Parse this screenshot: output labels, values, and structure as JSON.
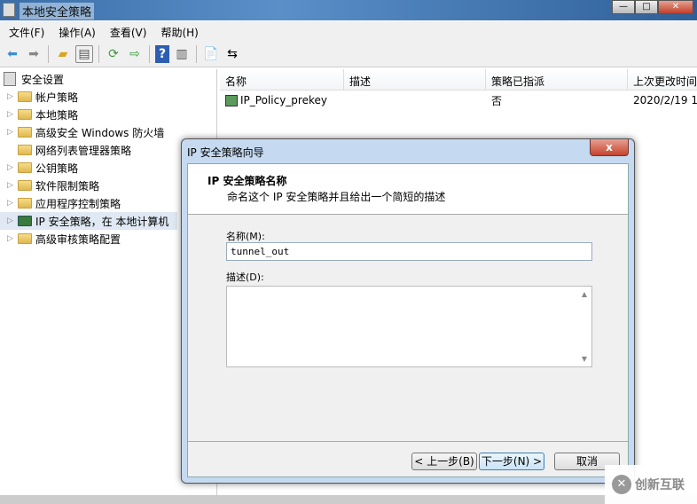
{
  "window": {
    "title": "本地安全策略",
    "minimize": "—",
    "maximize": "□",
    "close": "✕"
  },
  "menu": [
    "文件(F)",
    "操作(A)",
    "查看(V)",
    "帮助(H)"
  ],
  "toolbar": [
    "back-icon",
    "forward-icon",
    "up-folder-icon",
    "show-hide-tree-icon",
    "refresh-icon",
    "export-icon",
    "help-icon",
    "properties-icon",
    "new-policy-icon",
    "manage-filters-icon"
  ],
  "tree": {
    "root": "安全设置",
    "items": [
      "帐户策略",
      "本地策略",
      "高级安全 Windows 防火墙",
      "网络列表管理器策略",
      "公钥策略",
      "软件限制策略",
      "应用程序控制策略",
      "IP 安全策略，在 本地计算机",
      "高级审核策略配置"
    ]
  },
  "list": {
    "columns": [
      "名称",
      "描述",
      "策略已指派",
      "上次更改时间"
    ],
    "rows": [
      {
        "name": "IP_Policy_prekey",
        "desc": "",
        "assigned": "否",
        "modified": "2020/2/19 1"
      }
    ]
  },
  "dialog": {
    "title": "IP 安全策略向导",
    "close": "x",
    "heading": "IP 安全策略名称",
    "subheading": "命名这个 IP 安全策略并且给出一个简短的描述",
    "name_label": "名称(M):",
    "name_value": "tunnel_out",
    "desc_label": "描述(D):",
    "desc_value": "",
    "back": "< 上一步(B)",
    "next": "下一步(N) >",
    "cancel": "取消"
  },
  "watermark": {
    "text": "创新互联",
    "logo": "✕"
  }
}
